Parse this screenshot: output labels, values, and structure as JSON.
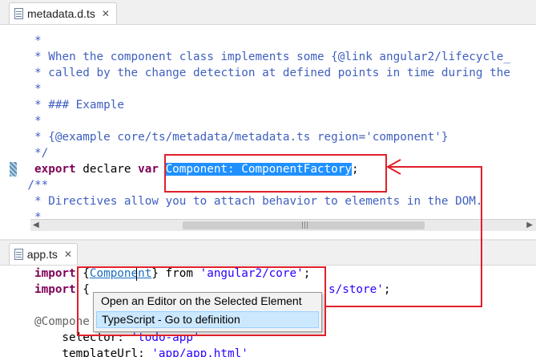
{
  "top_tab": {
    "filename": "metadata.d.ts",
    "close": "✕"
  },
  "bottom_tab": {
    "filename": "app.ts",
    "close": "✕"
  },
  "top_lines": [
    "     *",
    "     * When the component class implements some {@link angular2/lifecycle_",
    "     * called by the change detection at defined points in time during the",
    "     *",
    "     * ### Example",
    "     *",
    "     * {@example core/ts/metadata/metadata.ts region='component'}",
    "     */"
  ],
  "export_line": {
    "kw": "export",
    "mid": " declare ",
    "kw2": "var",
    "space": " ",
    "selected": "Component: ComponentFactory",
    "end": ";"
  },
  "after_lines": [
    "    /**",
    "     * Directives allow you to attach behavior to elements in the DOM.",
    "     *"
  ],
  "bottom_code": {
    "l1": {
      "kw": "import",
      "a": " {",
      "link": "Component",
      "b": "} from ",
      "str": "'angular2/core'",
      "c": ";"
    },
    "l2": {
      "kw": "import",
      "a": " {",
      "str": "s/store'",
      "c": ";"
    },
    "l4": "@Compone",
    "l5": {
      "a": "    selector: ",
      "str": "'todo-app'"
    },
    "l6": {
      "a": "    templateUrl: ",
      "str": "'app/app.html'"
    }
  },
  "context_menu": {
    "items": [
      "Open an Editor on the Selected Element",
      "TypeScript - Go to definition"
    ],
    "selected_index": 1
  },
  "scrollbar": {
    "left_arrow": "◀",
    "right_arrow": "▶",
    "grip": "|||"
  },
  "colors": {
    "comment": "#3f5fbf",
    "keyword": "#7f0055",
    "string": "#2a00ff",
    "selection": "#1e90ff",
    "annotation": "#e0202a"
  }
}
